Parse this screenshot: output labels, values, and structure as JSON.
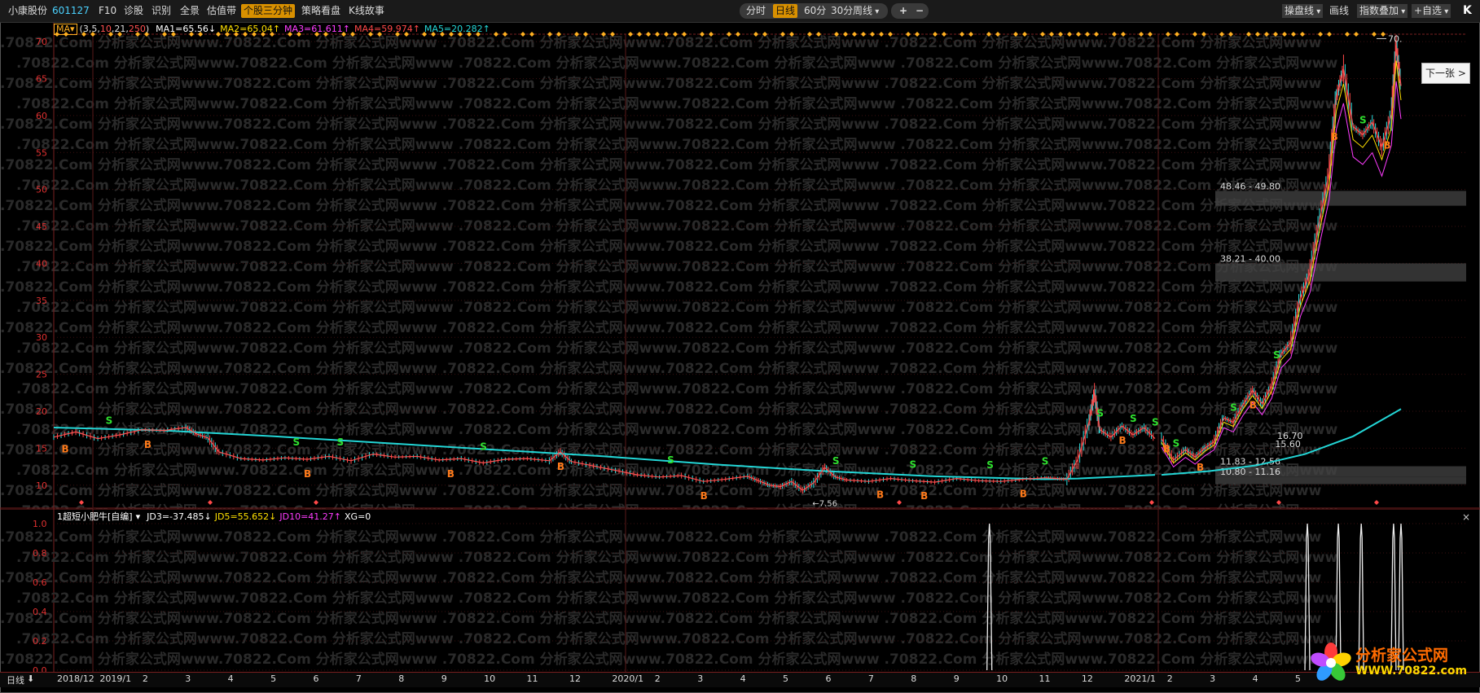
{
  "toolbar": {
    "stock_name": "小康股份",
    "stock_code": "601127",
    "items": [
      "F10",
      "诊股",
      "识别",
      "全景",
      "估值带",
      "个股三分钟",
      "策略看盘",
      "K线故事"
    ],
    "periods": [
      "分时",
      "日线",
      "60分",
      "30分",
      "周线"
    ],
    "zoom_in": "+",
    "zoom_out": "−",
    "right": [
      "操盘线",
      "画线",
      "指数叠加",
      "+自选"
    ],
    "k": "K"
  },
  "ma_header": {
    "button": "MA",
    "params_prefix": "(3,5,",
    "param_10": "10",
    "param_21": ",21,",
    "param_250": "250",
    "params_suffix": ")",
    "ma1": "MA1=65.56↓",
    "ma2": "MA2=65.04↑",
    "ma3": "MA3=61.611↑",
    "ma4": "MA4=59.974↑",
    "ma5": "MA5=20.282↑"
  },
  "indicator_header": {
    "name": "1超短小肥牛[自编]",
    "jd3": "JD3=-37.485↓",
    "jd5": "JD5=55.652↓",
    "jd10": "JD10=41.27↑",
    "xg": "XG=0"
  },
  "next_button": "下一张",
  "close_label": "×",
  "xaxis": {
    "period": "日线",
    "labels": [
      "2018/12",
      "2019/1",
      "2",
      "3",
      "4",
      "5",
      "6",
      "7",
      "8",
      "9",
      "10",
      "11",
      "12",
      "2020/1",
      "2",
      "3",
      "4",
      "5",
      "6",
      "7",
      "8",
      "9",
      "10",
      "11",
      "12",
      "2021/1",
      "2",
      "3",
      "4",
      "5"
    ]
  },
  "watermark": ".70822.Com  分析家公式网www.70822.Com  分析家公式网www",
  "brand": {
    "name": "分析家公式网",
    "url": "WWW.70822.com"
  },
  "chart_data": [
    {
      "type": "line",
      "title": "",
      "ylim": [
        7,
        71
      ],
      "y_ticks": [
        10,
        15,
        20,
        25,
        30,
        35,
        40,
        45,
        50,
        55,
        60,
        65,
        70
      ],
      "high_label": "70.",
      "low_label": "7.56",
      "price_bands": [
        {
          "label": "48.46 - 49.80",
          "low": 48.46,
          "high": 49.8
        },
        {
          "label": "38.21 - 40.00",
          "low": 38.21,
          "high": 40.0
        },
        {
          "label": "11.83 - 12.56",
          "low": 11.83,
          "high": 12.56
        },
        {
          "label": "10.80 - 11.16",
          "low": 10.8,
          "high": 11.16
        }
      ],
      "price_notes": [
        {
          "label": "15.60",
          "t": 0.862,
          "y": 15.6
        },
        {
          "label": "16.70",
          "t": 0.878,
          "y": 16.7
        }
      ],
      "series": [
        {
          "role": "price",
          "color": "#ff5050",
          "points": [
            [
              0,
              16.5
            ],
            [
              0.02,
              17.2
            ],
            [
              0.04,
              16.3
            ],
            [
              0.06,
              16.8
            ],
            [
              0.08,
              17.5
            ],
            [
              0.1,
              17.4
            ],
            [
              0.12,
              17.8
            ],
            [
              0.13,
              16.9
            ],
            [
              0.14,
              16.4
            ],
            [
              0.15,
              14.5
            ],
            [
              0.17,
              13.6
            ],
            [
              0.19,
              13.4
            ],
            [
              0.21,
              13.7
            ],
            [
              0.23,
              13.5
            ],
            [
              0.25,
              13.9
            ],
            [
              0.27,
              13.3
            ],
            [
              0.29,
              14.2
            ],
            [
              0.31,
              13.8
            ],
            [
              0.33,
              13.9
            ],
            [
              0.35,
              13.4
            ],
            [
              0.37,
              13.6
            ],
            [
              0.39,
              13.0
            ],
            [
              0.41,
              13.5
            ],
            [
              0.43,
              13.6
            ],
            [
              0.45,
              13.3
            ],
            [
              0.46,
              14.5
            ],
            [
              0.47,
              13.2
            ],
            [
              0.49,
              12.6
            ],
            [
              0.51,
              12.0
            ],
            [
              0.53,
              11.4
            ],
            [
              0.55,
              11.1
            ],
            [
              0.57,
              11.3
            ],
            [
              0.59,
              10.5
            ],
            [
              0.61,
              10.8
            ],
            [
              0.63,
              11.2
            ],
            [
              0.64,
              10.6
            ],
            [
              0.65,
              10.0
            ],
            [
              0.66,
              9.8
            ],
            [
              0.67,
              10.5
            ],
            [
              0.68,
              9.3
            ],
            [
              0.69,
              10.3
            ],
            [
              0.7,
              12.4
            ],
            [
              0.71,
              11.1
            ],
            [
              0.72,
              10.7
            ],
            [
              0.74,
              10.5
            ],
            [
              0.76,
              10.9
            ],
            [
              0.78,
              10.6
            ],
            [
              0.8,
              10.4
            ],
            [
              0.82,
              10.9
            ],
            [
              0.84,
              10.6
            ],
            [
              0.86,
              10.5
            ],
            [
              0.88,
              10.8
            ],
            [
              0.9,
              11.0
            ],
            [
              0.91,
              10.9
            ],
            [
              0.92,
              10.8
            ],
            [
              0.93,
              13.5
            ],
            [
              0.94,
              18.5
            ],
            [
              0.945,
              22.5
            ],
            [
              0.95,
              17.5
            ],
            [
              0.96,
              16.5
            ],
            [
              0.97,
              18.0
            ],
            [
              0.98,
              16.8
            ],
            [
              0.99,
              17.8
            ],
            [
              1.0,
              16.3
            ]
          ]
        },
        {
          "role": "ma250",
          "color": "#23d6d6",
          "points": [
            [
              0,
              17.8
            ],
            [
              0.1,
              17.4
            ],
            [
              0.2,
              16.6
            ],
            [
              0.3,
              15.7
            ],
            [
              0.4,
              14.8
            ],
            [
              0.5,
              13.9
            ],
            [
              0.6,
              12.8
            ],
            [
              0.7,
              11.9
            ],
            [
              0.8,
              11.2
            ],
            [
              0.9,
              10.8
            ],
            [
              0.93,
              10.9
            ],
            [
              0.96,
              11.1
            ],
            [
              1.0,
              11.4
            ]
          ]
        }
      ],
      "series_right": {
        "price": [
          [
            0,
            16.3
          ],
          [
            0.05,
            13.4
          ],
          [
            0.1,
            14.8
          ],
          [
            0.14,
            13.8
          ],
          [
            0.18,
            15.0
          ],
          [
            0.22,
            15.9
          ],
          [
            0.26,
            19.1
          ],
          [
            0.3,
            18.5
          ],
          [
            0.34,
            20.9
          ],
          [
            0.38,
            22.8
          ],
          [
            0.42,
            21.0
          ],
          [
            0.46,
            23.4
          ],
          [
            0.5,
            27.8
          ],
          [
            0.54,
            29.3
          ],
          [
            0.58,
            35.3
          ],
          [
            0.62,
            38.8
          ],
          [
            0.66,
            45.8
          ],
          [
            0.7,
            52.3
          ],
          [
            0.73,
            62.5
          ],
          [
            0.76,
            66.3
          ],
          [
            0.8,
            58.5
          ],
          [
            0.84,
            57.4
          ],
          [
            0.88,
            59.1
          ],
          [
            0.92,
            55.7
          ],
          [
            0.96,
            60.2
          ],
          [
            0.98,
            69.5
          ],
          [
            1.0,
            64.0
          ]
        ],
        "ma250": [
          [
            0,
            11.4
          ],
          [
            0.2,
            11.9
          ],
          [
            0.4,
            12.7
          ],
          [
            0.6,
            14.2
          ],
          [
            0.8,
            16.6
          ],
          [
            1.0,
            20.3
          ]
        ]
      },
      "signals_B": [
        0.01,
        0.085,
        0.23,
        0.36,
        0.46,
        0.59,
        0.75,
        0.79,
        0.88,
        0.97,
        1.01
      ],
      "signals_S": [
        0.05,
        0.22,
        0.26,
        0.39,
        0.56,
        0.71,
        0.78,
        0.85,
        0.9,
        0.95,
        0.98,
        1.0
      ]
    },
    {
      "type": "bar",
      "title": "",
      "ylim": [
        0,
        1
      ],
      "y_ticks": [
        0,
        0.2,
        0.4,
        0.6,
        0.8,
        1.0
      ],
      "spikes": [
        0.6945,
        0.9305,
        0.9535,
        0.9705,
        0.9945,
        1.0
      ]
    }
  ]
}
